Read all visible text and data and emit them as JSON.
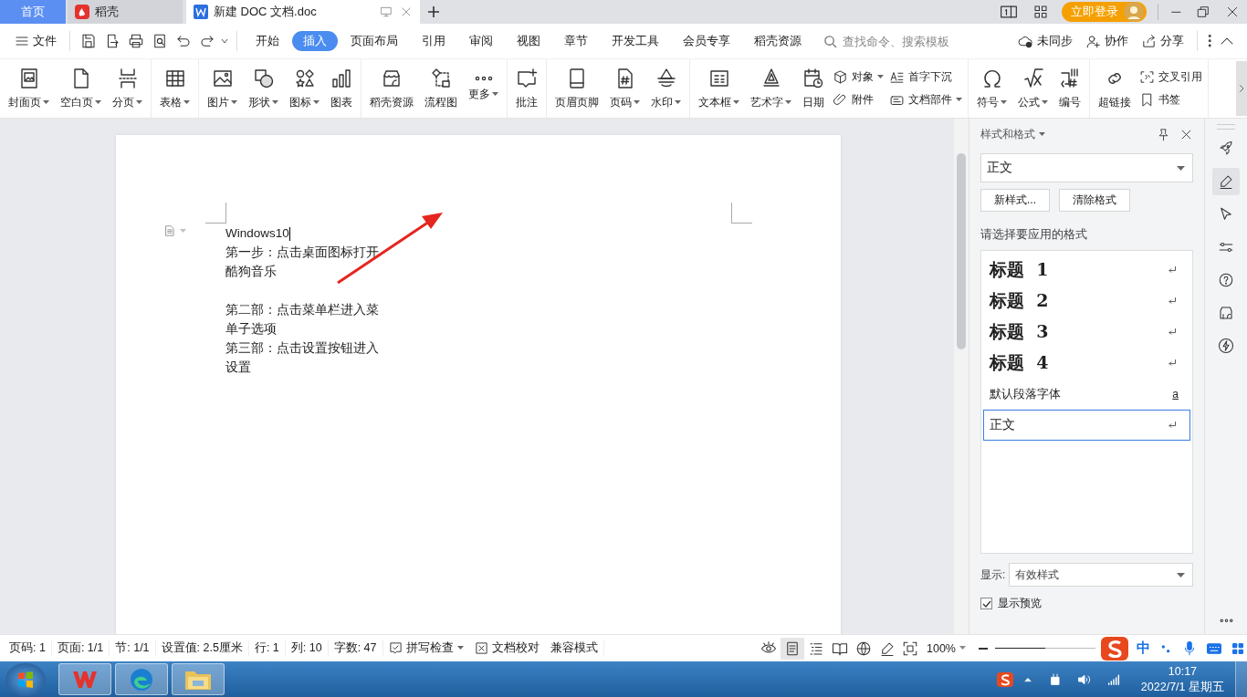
{
  "tabs": [
    {
      "label": "首页",
      "kind": "home",
      "selected": false
    },
    {
      "label": "稻壳",
      "kind": "docer",
      "selected": false
    },
    {
      "label": "新建 DOC 文档.doc",
      "kind": "doc",
      "selected": true
    }
  ],
  "login": "立即登录",
  "menu": {
    "file": "文件",
    "search_placeholder": "查找命令、搜索模板",
    "sync": "未同步",
    "collab": "协作",
    "share": "分享"
  },
  "ribbon_tabs": [
    {
      "label": "开始",
      "selected": false
    },
    {
      "label": "插入",
      "selected": true
    },
    {
      "label": "页面布局",
      "selected": false
    },
    {
      "label": "引用",
      "selected": false
    },
    {
      "label": "审阅",
      "selected": false
    },
    {
      "label": "视图",
      "selected": false
    },
    {
      "label": "章节",
      "selected": false
    },
    {
      "label": "开发工具",
      "selected": false
    },
    {
      "label": "会员专享",
      "selected": false
    },
    {
      "label": "稻壳资源",
      "selected": false
    }
  ],
  "ribbon": [
    {
      "items": [
        {
          "kind": "large",
          "label": "封面页",
          "dropdown": true
        },
        {
          "kind": "large",
          "label": "空白页",
          "dropdown": true
        },
        {
          "kind": "large",
          "label": "分页",
          "dropdown": true
        }
      ]
    },
    {
      "items": [
        {
          "kind": "large",
          "label": "表格",
          "dropdown": true
        }
      ]
    },
    {
      "items": [
        {
          "kind": "large",
          "label": "图片",
          "dropdown": true
        },
        {
          "kind": "large",
          "label": "形状",
          "dropdown": true
        },
        {
          "kind": "large",
          "label": "图标",
          "dropdown": true
        },
        {
          "kind": "large",
          "label": "图表",
          "dropdown": false
        }
      ]
    },
    {
      "items": [
        {
          "kind": "large",
          "label": "稻壳资源",
          "dropdown": false
        },
        {
          "kind": "large",
          "label": "流程图",
          "dropdown": false
        },
        {
          "kind": "large",
          "label": "更多",
          "dropdown": true
        }
      ]
    },
    {
      "items": [
        {
          "kind": "large",
          "label": "批注",
          "dropdown": false
        }
      ]
    },
    {
      "items": [
        {
          "kind": "large",
          "label": "页眉页脚",
          "dropdown": false
        },
        {
          "kind": "large",
          "label": "页码",
          "dropdown": true
        },
        {
          "kind": "large",
          "label": "水印",
          "dropdown": true
        }
      ]
    },
    {
      "items": [
        {
          "kind": "large",
          "label": "文本框",
          "dropdown": true
        },
        {
          "kind": "large",
          "label": "艺术字",
          "dropdown": true
        },
        {
          "kind": "large",
          "label": "日期",
          "dropdown": false
        },
        {
          "kind": "stack",
          "items": [
            {
              "label": "对象",
              "dropdown": true
            },
            {
              "label": "附件",
              "dropdown": false
            }
          ]
        },
        {
          "kind": "stack",
          "items": [
            {
              "label": "首字下沉",
              "dropdown": false
            },
            {
              "label": "文档部件",
              "dropdown": true
            }
          ]
        }
      ]
    },
    {
      "items": [
        {
          "kind": "large",
          "label": "符号",
          "dropdown": true
        },
        {
          "kind": "large",
          "label": "公式",
          "dropdown": true
        },
        {
          "kind": "large",
          "label": "编号",
          "dropdown": false
        }
      ]
    },
    {
      "items": [
        {
          "kind": "large",
          "label": "超链接",
          "dropdown": false
        },
        {
          "kind": "stack",
          "items": [
            {
              "label": "交叉引用",
              "dropdown": false
            },
            {
              "label": "书签",
              "dropdown": false
            }
          ]
        }
      ]
    }
  ],
  "document": {
    "paragraphs": [
      {
        "text": "Windows10",
        "blank_after": false,
        "cursor": true
      },
      {
        "text": "第一步：点击桌面图标打开酷狗音乐",
        "blank_after": true,
        "cursor": false
      },
      {
        "text": "第二部：点击菜单栏进入菜单子选项",
        "blank_after": false,
        "cursor": false
      },
      {
        "text": "第三部：点击设置按钮进入设置",
        "blank_after": false,
        "cursor": false
      }
    ]
  },
  "styles": {
    "title": "样式和格式",
    "current": "正文",
    "new_button": "新样式...",
    "clear_button": "清除格式",
    "prompt": "请选择要应用的格式",
    "list": [
      {
        "name": "标题  1",
        "kind": "heading",
        "selected": false
      },
      {
        "name": "标题  2",
        "kind": "heading",
        "selected": false
      },
      {
        "name": "标题  3",
        "kind": "heading",
        "selected": false
      },
      {
        "name": "标题  4",
        "kind": "heading",
        "selected": false
      },
      {
        "name": "默认段落字体",
        "kind": "character",
        "symbol": "a",
        "selected": false
      },
      {
        "name": "正文",
        "kind": "paragraph",
        "selected": true
      }
    ],
    "show_label": "显示:",
    "show_value": "有效样式",
    "preview": {
      "label": "显示预览",
      "checked": true
    }
  },
  "side_tools": [
    {
      "selected": false
    },
    {
      "selected": true
    },
    {
      "selected": false
    },
    {
      "selected": false
    },
    {
      "selected": false
    },
    {
      "selected": false
    },
    {
      "selected": false
    }
  ],
  "status": {
    "fields": [
      "页码: 1",
      "页面: 1/1",
      "节: 1/1",
      "设置值: 2.5厘米",
      "行: 1",
      "列: 10",
      "字数: 47"
    ],
    "spell": "拼写检查",
    "proof": "文档校对",
    "compat": "兼容模式",
    "views": [
      {
        "selected": false
      },
      {
        "selected": true
      },
      {
        "selected": false
      },
      {
        "selected": false
      },
      {
        "selected": false
      },
      {
        "selected": false
      }
    ],
    "zoom": {
      "label": "100%",
      "level": 0.5
    }
  },
  "ime": {
    "mode": "中"
  },
  "taskbar": {
    "time": "10:17",
    "date": "2022/7/1 星期五"
  }
}
